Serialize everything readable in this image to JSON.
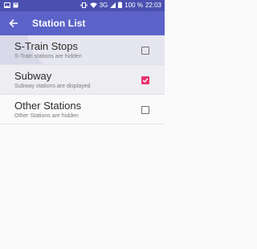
{
  "status_bar": {
    "left_icons": [
      "gallery-icon",
      "notification-icon"
    ],
    "right_icons": [
      "vibrate-icon",
      "wifi-icon"
    ],
    "network": "3G",
    "battery_percent": "100 %",
    "time": "22:03"
  },
  "toolbar": {
    "title": "Station List",
    "back_icon": "arrow-left-icon"
  },
  "colors": {
    "status_bar": "#4a4fb0",
    "toolbar": "#5b62c8",
    "checkbox_checked": "#e8336b"
  },
  "items": [
    {
      "title": "S-Train Stops",
      "subtitle": "S-Train stations are hidden",
      "checked": false
    },
    {
      "title": "Subway",
      "subtitle": "Subway stations are displayed",
      "checked": true
    },
    {
      "title": "Other Stations",
      "subtitle": "Other Stations are hidden",
      "checked": false
    }
  ]
}
